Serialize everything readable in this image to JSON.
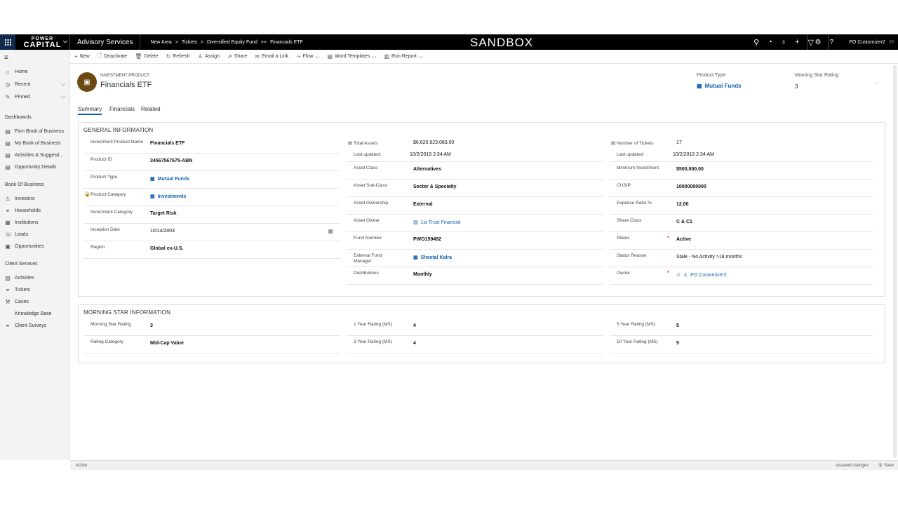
{
  "topnav": {
    "logo_line1": "POWER",
    "logo_line2": "CAPITAL",
    "app_name": "Advisory Services",
    "breadcrumbs": [
      "New Area",
      ">",
      "Tickets",
      ">",
      "Diversified Equity Fund",
      ">>",
      "Financials ETF"
    ],
    "environment": "SANDBOX",
    "user": "PO Customizer2"
  },
  "leftnav": {
    "top_items": [
      {
        "icon": "home-icon",
        "label": "Home"
      },
      {
        "icon": "clock-icon",
        "label": "Recent"
      },
      {
        "icon": "pin-icon",
        "label": "Pinned"
      }
    ],
    "groups": [
      {
        "heading": "Dashboards",
        "items": [
          {
            "icon": "dashboard-icon",
            "label": "Firm Book of Business"
          },
          {
            "icon": "dashboard-icon",
            "label": "My Book of Business"
          },
          {
            "icon": "dashboard-icon",
            "label": "Activities & Suggesti..."
          },
          {
            "icon": "dashboard-icon",
            "label": "Opportunity Details"
          }
        ]
      },
      {
        "heading": "Book Of Business",
        "items": [
          {
            "icon": "person-icon",
            "label": "Investors"
          },
          {
            "icon": "household-icon",
            "label": "Households"
          },
          {
            "icon": "building-icon",
            "label": "Institutions"
          },
          {
            "icon": "phone-icon",
            "label": "Leads"
          },
          {
            "icon": "opportunity-icon",
            "label": "Opportunities"
          }
        ]
      },
      {
        "heading": "Client Services",
        "items": [
          {
            "icon": "activity-icon",
            "label": "Activities"
          },
          {
            "icon": "ticket-icon",
            "label": "Tickets"
          },
          {
            "icon": "wrench-icon",
            "label": "Cases"
          },
          {
            "icon": "dot-icon",
            "label": "Knowledge Base"
          },
          {
            "icon": "survey-icon",
            "label": "Client Surveys"
          }
        ]
      }
    ]
  },
  "commands": [
    {
      "icon": "plus-icon",
      "label": "New"
    },
    {
      "icon": "deactivate-icon",
      "label": "Deactivate"
    },
    {
      "icon": "trash-icon",
      "label": "Delete"
    },
    {
      "icon": "refresh-icon",
      "label": "Refresh"
    },
    {
      "icon": "assign-icon",
      "label": "Assign"
    },
    {
      "icon": "share-icon",
      "label": "Share"
    },
    {
      "icon": "email-icon",
      "label": "Email a Link"
    },
    {
      "icon": "flow-icon",
      "label": "Flow"
    },
    {
      "icon": "word-icon",
      "label": "Word Templates"
    },
    {
      "icon": "report-icon",
      "label": "Run Report"
    }
  ],
  "header": {
    "entity_type": "INVESTMENT PRODUCT",
    "title": "Financials ETF",
    "product_type_label": "Product Type",
    "product_type_value": "Mutual Funds",
    "ms_rating_label": "Morning Star Rating",
    "ms_rating_value": "3"
  },
  "tabs": [
    "Summary",
    "Financials",
    "Related"
  ],
  "general": {
    "title": "GENERAL INFORMATION",
    "col1": [
      {
        "label": "Investment Product Name",
        "value": "Financials ETF"
      },
      {
        "label": "Product ID",
        "value": "34567567675-ABN"
      },
      {
        "label": "Product Type",
        "value": "Mutual Funds"
      },
      {
        "label": "Product Category",
        "value": "Investments"
      },
      {
        "label": "Investment Category",
        "value": "Target Risk"
      },
      {
        "label": "Inception Date",
        "value": "10/14/2003"
      },
      {
        "label": "Region",
        "value": "Global ex-U.S."
      }
    ],
    "col2_top": {
      "label": "Total Assets",
      "value": "$6,820,923,083.00",
      "updated_label": "Last updated:",
      "updated_value": "10/2/2019 2:34 AM"
    },
    "col2": [
      {
        "label": "Asset Class",
        "value": "Alternatives"
      },
      {
        "label": "Asset Sub-Class",
        "value": "Sector & Specialty"
      },
      {
        "label": "Asset Ownership",
        "value": "External"
      },
      {
        "label": "Asset Owner",
        "value": "1st Trust Financial"
      },
      {
        "label": "Fund Number",
        "value": "PWO159492"
      },
      {
        "label": "External Fund Manager",
        "value": "Sheetal Kalra"
      },
      {
        "label": "Distributions",
        "value": "Monthly"
      }
    ],
    "col3_top": {
      "label": "Number of Tickets",
      "value": "17",
      "updated_label": "Last updated:",
      "updated_value": "10/2/2019 2:34 AM"
    },
    "col3": [
      {
        "label": "Minimum Investment",
        "value": "$500,000.00"
      },
      {
        "label": "CUSIP",
        "value": "10000000000"
      },
      {
        "label": "Expense Ratio %",
        "value": "12.00"
      },
      {
        "label": "Share Class",
        "value": "C & C1"
      },
      {
        "label": "Status",
        "value": "Active"
      },
      {
        "label": "Status Reason",
        "value": "Stale - No Activity >18 months"
      },
      {
        "label": "Owner",
        "value": "PO Customizer2"
      }
    ]
  },
  "morningstar": {
    "title": "MORNING STAR INFORMATION",
    "fields": [
      {
        "label": "Morning Star Rating",
        "value": "3"
      },
      {
        "label": "Rating Category",
        "value": "Mid-Cap Value"
      },
      {
        "label": "1 Year Rating (MS)",
        "value": "4"
      },
      {
        "label": "3 Year Rating (MS)",
        "value": "4"
      },
      {
        "label": "5 Year Rating (MS)",
        "value": "5"
      },
      {
        "label": "10 Year Rating (MS)",
        "value": "5"
      }
    ]
  },
  "footer": {
    "status": "Active",
    "unsaved": "unsaved changes",
    "save": "Save"
  }
}
